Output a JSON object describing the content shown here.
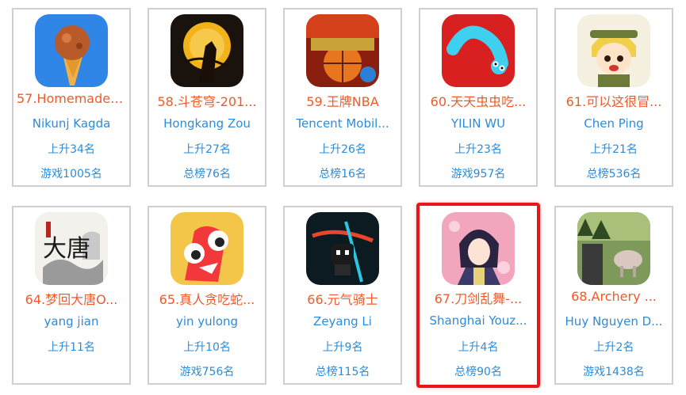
{
  "apps": [
    {
      "title": "57.Homemade ...",
      "developer": "Nikunj Kagda",
      "rise": "上升34名",
      "rank": "游戏1005名",
      "icon": "ice-cream-icon"
    },
    {
      "title": "58.斗苍穹-201...",
      "developer": "Hongkang Zou",
      "rise": "上升27名",
      "rank": "总榜76名",
      "icon": "warrior-moon-icon"
    },
    {
      "title": "59.王牌NBA",
      "developer": "Tencent Mobil...",
      "rise": "上升26名",
      "rank": "总榜16名",
      "icon": "basketball-icon"
    },
    {
      "title": "60.天天虫虫吃...",
      "developer": "YILIN WU",
      "rise": "上升23名",
      "rank": "游戏957名",
      "icon": "worm-icon"
    },
    {
      "title": "61.可以这很冒...",
      "developer": "Chen Ping",
      "rise": "上升21名",
      "rank": "总榜536名",
      "icon": "adventurer-girl-icon"
    },
    {
      "title": "64.梦回大唐O...",
      "developer": "yang jian",
      "rise": "上升11名",
      "rank": "",
      "icon": "calligraphy-datang-icon",
      "icon_text": "大唐"
    },
    {
      "title": "65.真人贪吃蛇...",
      "developer": "yin yulong",
      "rise": "上升10名",
      "rank": "游戏756名",
      "icon": "red-snake-icon"
    },
    {
      "title": "66.元气骑士",
      "developer": "Zeyang Li",
      "rise": "上升9名",
      "rank": "总榜115名",
      "icon": "soul-knight-icon"
    },
    {
      "title": "67.刀剑乱舞-...",
      "developer": "Shanghai Youz...",
      "rise": "上升4名",
      "rank": "总榜90名",
      "icon": "sword-dancer-icon"
    },
    {
      "title": "68.Archery ...",
      "developer": "Huy Nguyen D...",
      "rise": "上升2名",
      "rank": "游戏1438名",
      "icon": "archery-forest-icon"
    }
  ],
  "highlighted_index": 8,
  "highlight_color": "#e8161b"
}
